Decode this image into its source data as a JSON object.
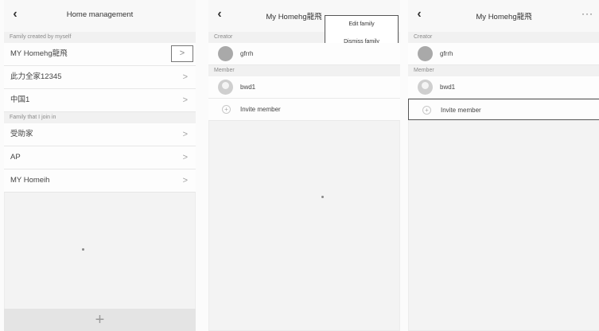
{
  "screens": {
    "home": {
      "title": "Home management",
      "section_mine": "Family created by myself",
      "mine": [
        "MY Homehg龍飛",
        "此力全家12345",
        "中国1"
      ],
      "section_joined": "Family that I join in",
      "joined": [
        "受助家",
        "AP",
        "MY Homeih"
      ],
      "add_label": "+",
      "chevron": ">"
    },
    "detail_menu": {
      "title": "My Homehg龍飛",
      "creator_label": "Creator",
      "creator": "gfrrh",
      "member_label": "Member",
      "member": "bwd1",
      "invite": "Invite member",
      "menu": [
        "Edit family",
        "Dismiss family"
      ]
    },
    "detail": {
      "title": "My Homehg龍飛",
      "more": "···",
      "creator_label": "Creator",
      "creator": "gfrrh",
      "member_label": "Member",
      "member": "bwd1",
      "invite": "Invite member"
    }
  }
}
